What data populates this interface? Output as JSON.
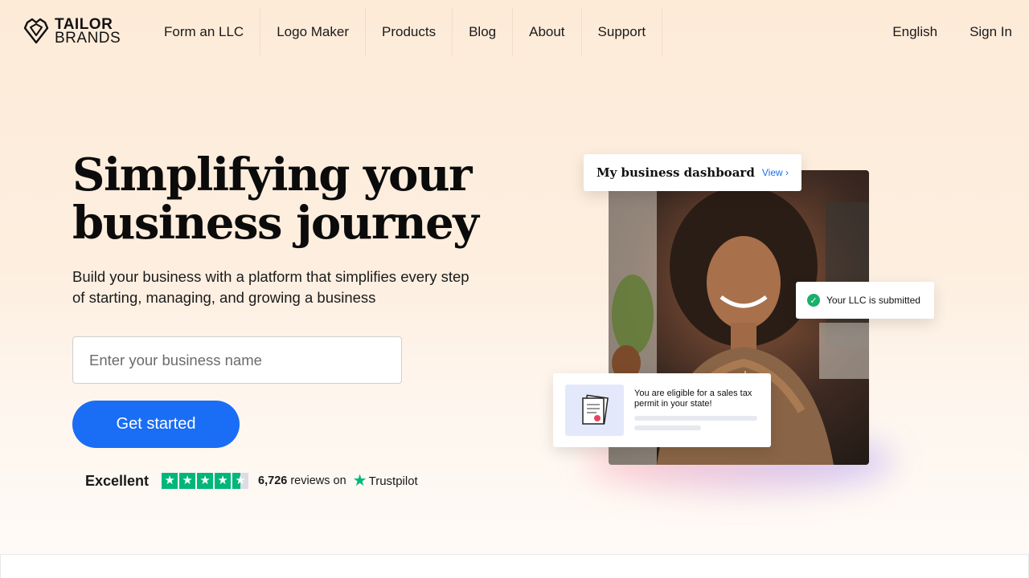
{
  "brand": {
    "line1": "TAILOR",
    "line2": "BRANDS"
  },
  "nav": {
    "items": [
      {
        "label": "Form an LLC"
      },
      {
        "label": "Logo Maker"
      },
      {
        "label": "Products"
      },
      {
        "label": "Blog"
      },
      {
        "label": "About"
      },
      {
        "label": "Support"
      }
    ],
    "language": "English",
    "sign_in": "Sign In"
  },
  "hero": {
    "title": "Simplifying your business journey",
    "subtitle": "Build your business with a platform that simplifies every step of starting, managing, and growing a business",
    "input_placeholder": "Enter your business name",
    "cta": "Get started"
  },
  "trust": {
    "rating_text": "Excellent",
    "stars": 4.5,
    "count": "6,726",
    "reviews_on": "reviews on",
    "provider": "Trustpilot"
  },
  "visual": {
    "dashboard_title": "My business dashboard",
    "dashboard_link": "View",
    "llc_status": "Your LLC is submitted",
    "tax_notice": "You are eligible for a sales tax permit in your state!"
  },
  "colors": {
    "accent": "#1a6df5",
    "trustpilot_green": "#00b67a",
    "success_green": "#19b06a"
  }
}
